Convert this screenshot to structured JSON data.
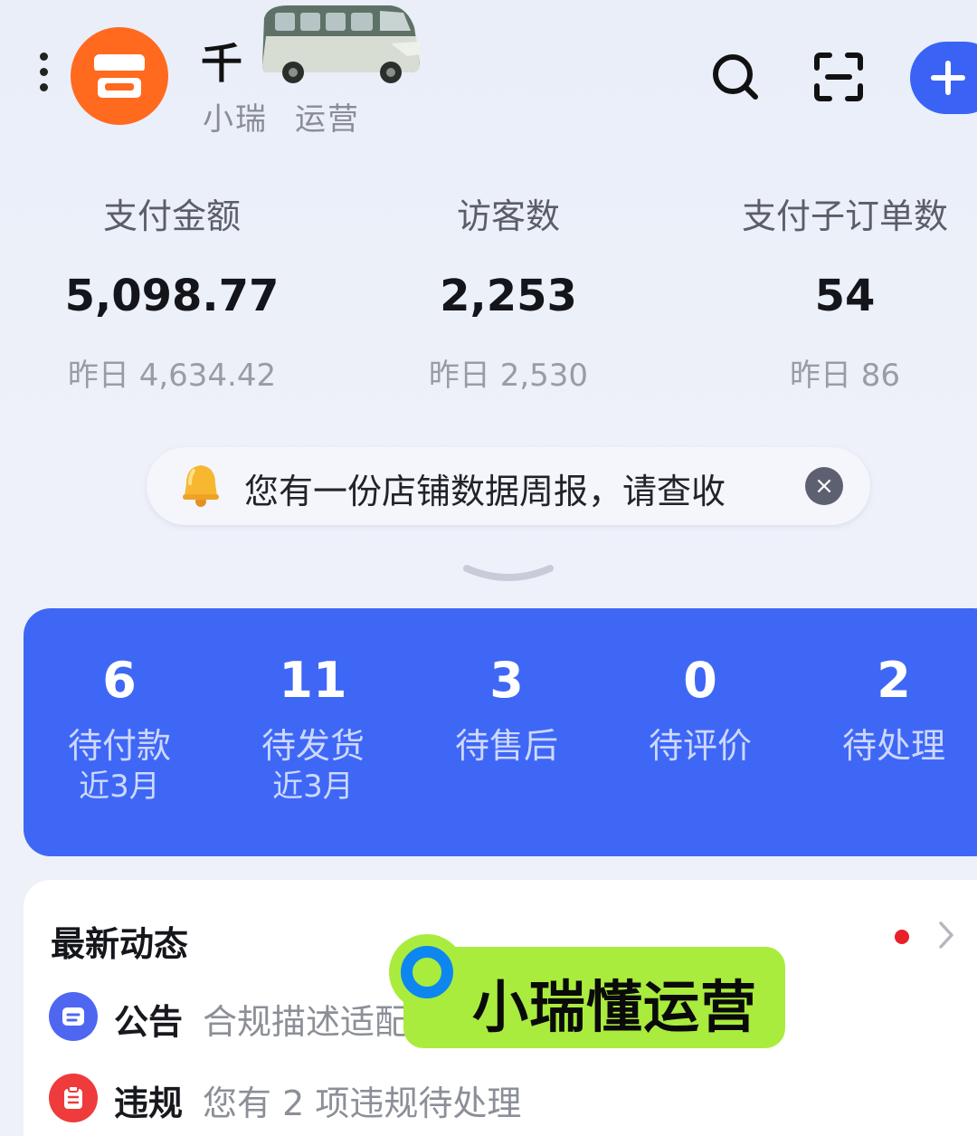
{
  "header": {
    "shop_name": "千",
    "sub_items": [
      "小瑞",
      "运营"
    ],
    "icons": [
      "more-icon",
      "shop-logo-icon",
      "search-icon",
      "scan-icon",
      "add-icon"
    ]
  },
  "stats": [
    {
      "label": "支付金额",
      "value": "5,098.77",
      "yesterday": "昨日 4,634.42"
    },
    {
      "label": "访客数",
      "value": "2,253",
      "yesterday": "昨日 2,530"
    },
    {
      "label": "支付子订单数",
      "value": "54",
      "yesterday": "昨日 86"
    }
  ],
  "notice": {
    "text": "您有一份店铺数据周报，请查收",
    "close": "×"
  },
  "orders": [
    {
      "count": "6",
      "label": "待付款",
      "sub": "近3月"
    },
    {
      "count": "11",
      "label": "待发货",
      "sub": "近3月"
    },
    {
      "count": "3",
      "label": "待售后",
      "sub": ""
    },
    {
      "count": "0",
      "label": "待评价",
      "sub": ""
    },
    {
      "count": "2",
      "label": "待处理",
      "sub": ""
    }
  ],
  "news": {
    "title": "最新动态",
    "rows": [
      {
        "type": "公告",
        "text": "合规描述适配"
      },
      {
        "type": "违规",
        "text": "您有 2 项违规待处理"
      }
    ]
  },
  "brand_tag": {
    "text": "小瑞懂运营"
  },
  "colors": {
    "accent": "#3f67f6",
    "shop_logo": "#ff6a1f",
    "brand_tag": "#a9ec3d",
    "alert_dot": "#e8202a"
  }
}
